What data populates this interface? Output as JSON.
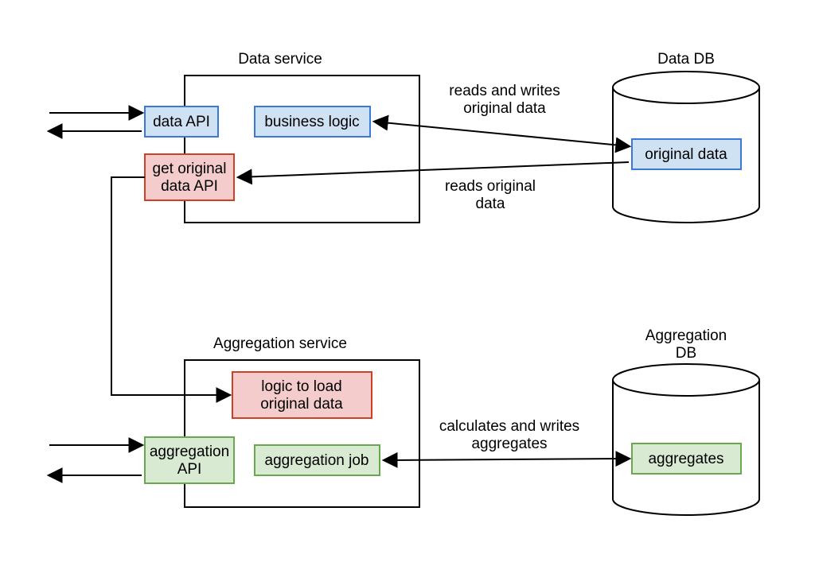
{
  "titles": {
    "data_service": "Data service",
    "data_db": "Data DB",
    "aggregation_service": "Aggregation service",
    "aggregation_db": "Aggregation\nDB"
  },
  "boxes": {
    "data_api": "data API",
    "business_logic": "business logic",
    "get_original_data_api": "get original\ndata API",
    "original_data": "original data",
    "logic_load": "logic to load\noriginal data",
    "aggregation_api": "aggregation\nAPI",
    "aggregation_job": "aggregation job",
    "aggregates": "aggregates"
  },
  "edge_labels": {
    "reads_writes": "reads and writes\noriginal data",
    "reads_original": "reads original\ndata",
    "calc_writes": "calculates and writes\naggregates"
  },
  "colors": {
    "blue_fill": "#cfe2f3",
    "blue_stroke": "#3c78d8",
    "red_fill": "#f4cccc",
    "red_stroke": "#cc4125",
    "green_fill": "#d9ead3",
    "green_stroke": "#6aa84f",
    "black": "#000000"
  }
}
